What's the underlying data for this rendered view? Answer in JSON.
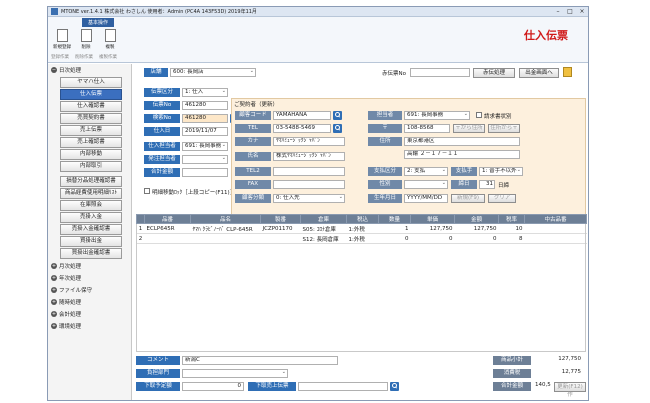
{
  "window": {
    "title": "MTONE ver.1.4.1  株式会社 わさしん  使用者：Admin (PC4A 143F53D)  2019年11月"
  },
  "ribbon": {
    "tab": "基本操作",
    "buttons": [
      {
        "label": "新規登録"
      },
      {
        "label": "削除"
      },
      {
        "label": "複製"
      }
    ],
    "groups": [
      "登録作業",
      "削除作業",
      "複製作業"
    ]
  },
  "brand": "仕入伝票",
  "sidebar": {
    "sections": [
      {
        "label": "日次処理",
        "marker": "−"
      },
      {
        "label": "月次処理",
        "marker": "+"
      },
      {
        "label": "年次処理",
        "marker": "+"
      },
      {
        "label": "ファイル保守",
        "marker": "+"
      },
      {
        "label": "随時処理",
        "marker": "+"
      },
      {
        "label": "会計処理",
        "marker": "+"
      },
      {
        "label": "環境処理",
        "marker": "+"
      }
    ],
    "items": [
      {
        "label": "ヤマハ仕入"
      },
      {
        "label": "仕入伝票",
        "active": true
      },
      {
        "label": "仕入確認書"
      },
      {
        "label": "売買契約書"
      },
      {
        "label": "売上伝票"
      },
      {
        "label": "売上確認書"
      },
      {
        "label": "内部移動"
      },
      {
        "label": "内部取引"
      },
      {
        "label": "損替分品処理確認書"
      },
      {
        "label": "商品経費使用明細ﾘｽﾄ"
      },
      {
        "label": "在庫照会"
      },
      {
        "label": "売掛入金"
      },
      {
        "label": "売掛入金確認書"
      },
      {
        "label": "買掛出金"
      },
      {
        "label": "買掛出金確認書"
      }
    ]
  },
  "header": {
    "store_label": "店舗",
    "store_value": "600: 長岡店",
    "cancel_label": "赤伝票No",
    "cancel_value": "",
    "cancel_button": "赤伝処理",
    "copy_button": "出金画面へ"
  },
  "form": {
    "division_label": "伝票区分",
    "division_value": "1: 仕入",
    "slip_label": "伝票No",
    "slip_value": "461280",
    "inspect_label": "検索No",
    "inspect_value": "461280",
    "date_label": "仕入日",
    "date_value": "2019/11/07",
    "staff_label": "仕入担当者",
    "staff_value": "691: 長岡事務",
    "order_label": "発注担当者",
    "order_value": "",
    "total_label": "合計金額",
    "total_value": "",
    "invoice_check": "明細移動ﾛｯｸ［上段コピー(F11)］"
  },
  "contract": {
    "title": "ご契約者（更新）",
    "code_label": "顧客コード",
    "code_value": "YAMAHANA",
    "tel_label": "TEL",
    "tel_value": "03-5488-5469",
    "kana_label": "カナ",
    "kana_value": "ﾔﾏﾊﾐｭｰｼﾞｯｸｼﾞｬﾊﾟﾝ",
    "name_label": "氏名",
    "name_value": "株式ﾔﾏﾊﾐｭｰｼﾞｯｸｼﾞｬﾊﾟﾝ",
    "tel2_label": "TEL2",
    "tel2_value": "",
    "fax_label": "FAX",
    "fax_value": "",
    "type_label": "顧客分類",
    "type_value": "0: 仕入先",
    "rep_label": "担当者",
    "rep_value": "691: 長岡事務",
    "invoice_label": "請求書状別",
    "zip_label": "〒",
    "zip_value": "108-8568",
    "zip_btn1": "〒から住所",
    "zip_btn2": "住所から〒",
    "addr_label": "住所",
    "addr_value": "東京都港区",
    "addr2_value": "高輪 ２－１７－１１",
    "pay_label": "支払区分",
    "pay_value": "2: 支払",
    "bank_label": "支払手",
    "bank_value": "1: 普手不以外",
    "sex_label": "性別",
    "sex_value": "",
    "close_label": "締日",
    "close_value": "31",
    "close_unit": "日締",
    "birth_label": "生年月日",
    "birth_value": "YYYY/MM/DD",
    "birth_btn": "新規(F9)",
    "clear_btn": "クリア"
  },
  "table": {
    "headers": [
      "",
      "品番",
      "品名",
      "製番",
      "倉庫",
      "税込",
      "数量",
      "単価",
      "金額",
      "税率",
      "中古品番"
    ],
    "rows": [
      [
        "1",
        "ECLP645R",
        "ﾔﾏﾊ ｸﾗﾋﾞﾉｰﾊﾞ CLP-645R",
        "JCZP01170",
        "S05: ｺﾛﾅ倉庫",
        "1:外税",
        "1",
        "127,750",
        "127,750",
        "10",
        ""
      ],
      [
        "2",
        "",
        "",
        "",
        "S12: 長岡倉庫",
        "1:外税",
        "0",
        "0",
        "0",
        "8",
        ""
      ]
    ]
  },
  "footer": {
    "comment_label": "コメント",
    "comment_value": "新潟C",
    "dept_label": "負担部門",
    "dept_value": "",
    "reserve_label": "下取予定額",
    "reserve_value": "0",
    "trade_label": "下取売上伝票",
    "trade_value": "",
    "subtotal_label": "商品小計",
    "subtotal_value": "127,750",
    "tax_label": "消費税",
    "tax_value": "12,775",
    "grand_label": "合計金額",
    "grand_value": "140,525",
    "update_btn": "更新(F12)作"
  },
  "colors": {
    "accent": "#2f6eb5",
    "brand": "#d01818",
    "panel": "#fdf0dd"
  }
}
